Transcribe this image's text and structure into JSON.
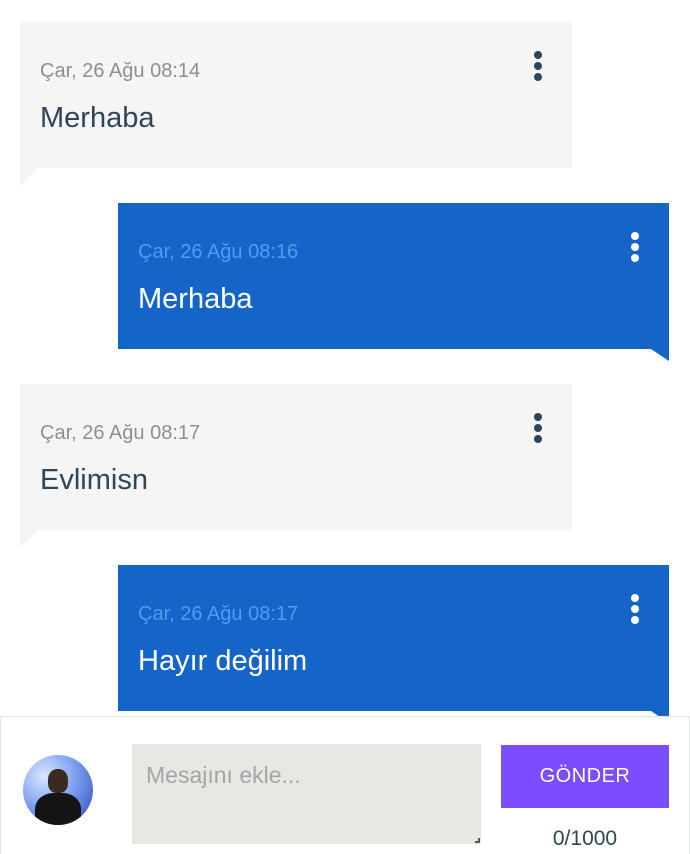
{
  "messages": [
    {
      "direction": "incoming",
      "timestamp": "Çar, 26 Ağu 08:14",
      "text": "Merhaba"
    },
    {
      "direction": "outgoing",
      "timestamp": "Çar, 26 Ağu 08:16",
      "text": "Merhaba"
    },
    {
      "direction": "incoming",
      "timestamp": "Çar, 26 Ağu 08:17",
      "text": "Evlimisn"
    },
    {
      "direction": "outgoing",
      "timestamp": "Çar, 26 Ağu 08:17",
      "text": "Hayır değilim"
    }
  ],
  "composer": {
    "placeholder": "Mesajını ekle...",
    "value": "",
    "send_label": "GÖNDER",
    "counter": "0/1000"
  },
  "icons": {
    "message_menu": "more-vert-icon",
    "avatar": "user-avatar"
  },
  "colors": {
    "incoming_bubble": "#f5f5f5",
    "outgoing_bubble": "#1565c8",
    "send_button": "#7c4dff",
    "text_dark": "#2e4657"
  }
}
